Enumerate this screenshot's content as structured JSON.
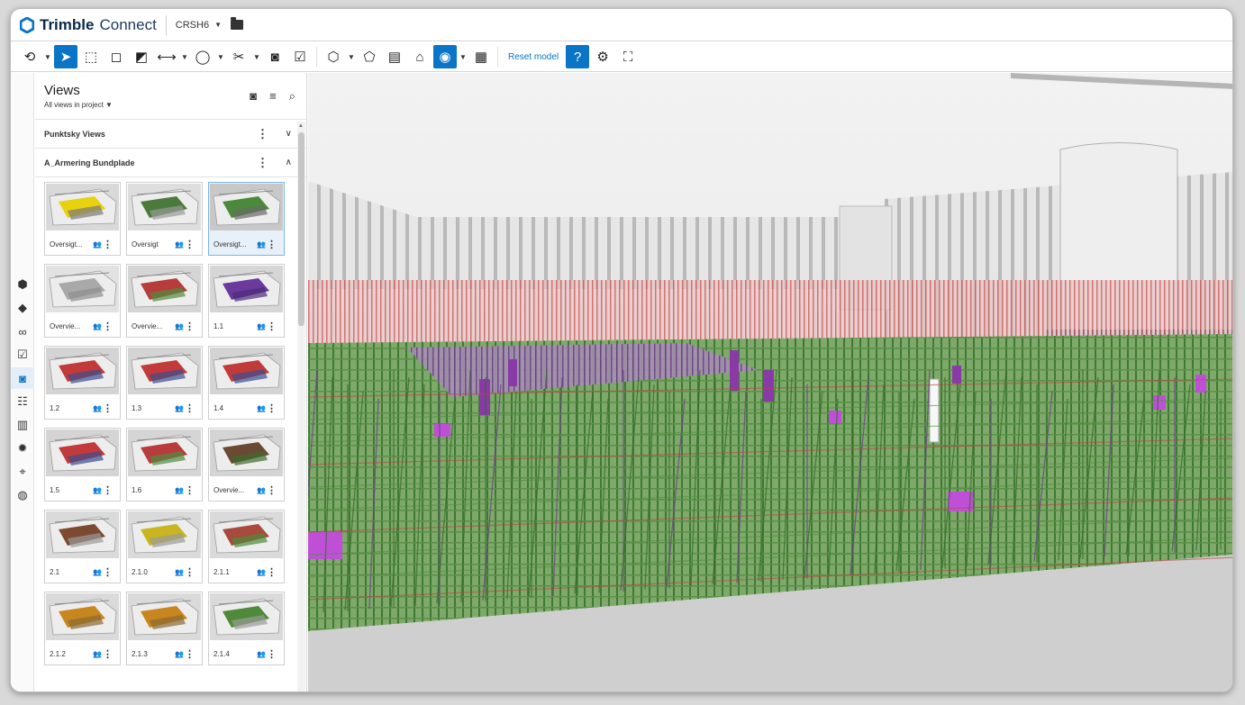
{
  "app": {
    "brand_strong": "Trimble",
    "brand_light": "Connect",
    "project": "CRSH6"
  },
  "toolbar": {
    "reset_label": "Reset model"
  },
  "panel": {
    "title": "Views",
    "subtitle": "All views in project",
    "groups": [
      {
        "label": "Punktsky Views",
        "expanded": false
      },
      {
        "label": "A_Armering Bundplade",
        "expanded": true
      }
    ],
    "views": [
      {
        "label": "Oversigt...",
        "theme": "yellow"
      },
      {
        "label": "Oversigt",
        "theme": "grey-green"
      },
      {
        "label": "Oversigt...",
        "theme": "green",
        "selected": true
      },
      {
        "label": "Overvie...",
        "theme": "grey"
      },
      {
        "label": "Overvie...",
        "theme": "red-green"
      },
      {
        "label": "1.1",
        "theme": "purple"
      },
      {
        "label": "1.2",
        "theme": "red-blue"
      },
      {
        "label": "1.3",
        "theme": "red-blue"
      },
      {
        "label": "1.4",
        "theme": "red-blue"
      },
      {
        "label": "1.5",
        "theme": "red-blue"
      },
      {
        "label": "1.6",
        "theme": "red-green"
      },
      {
        "label": "Overvie...",
        "theme": "brown"
      },
      {
        "label": "2.1",
        "theme": "brown-site"
      },
      {
        "label": "2.1.0",
        "theme": "yellow-site"
      },
      {
        "label": "2.1.1",
        "theme": "red-site"
      },
      {
        "label": "2.1.2",
        "theme": "orange-site"
      },
      {
        "label": "2.1.3",
        "theme": "orange-site"
      },
      {
        "label": "2.1.4",
        "theme": "green-site"
      }
    ]
  },
  "colors": {
    "accent": "#0a74c7",
    "rebar_green": "#4f8f3f",
    "rebar_red": "#c84848",
    "rebar_purple": "#7a3fa0",
    "column_magenta": "#b03cc8"
  }
}
